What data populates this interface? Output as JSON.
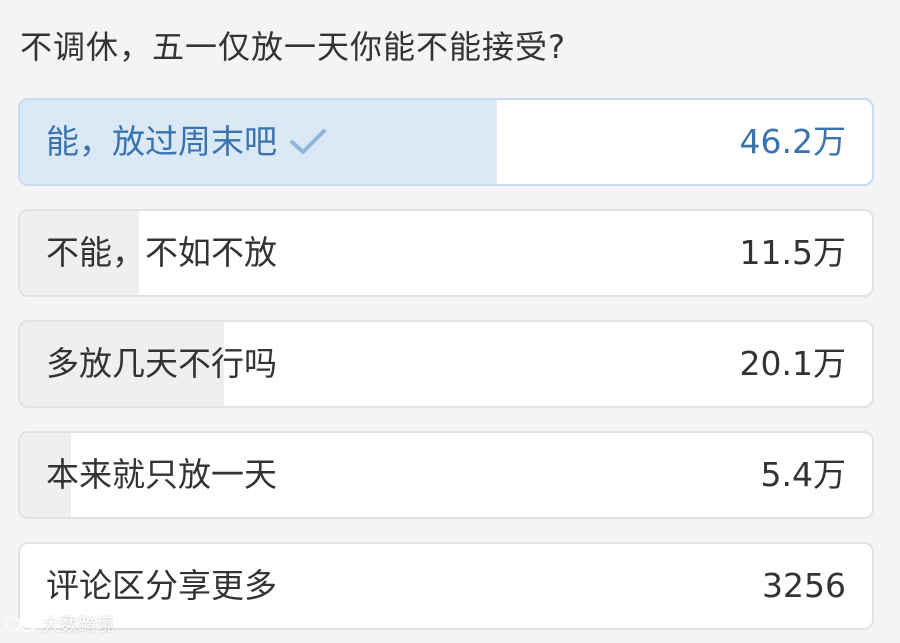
{
  "poll": {
    "question": "不调休，五一仅放一天你能不能接受?",
    "options": [
      {
        "label": "能，放过周末吧",
        "count": "46.2万",
        "share": 0.56,
        "selected": true
      },
      {
        "label": "不能，不如不放",
        "count": "11.5万",
        "share": 0.14,
        "selected": false
      },
      {
        "label": "多放几天不行吗",
        "count": "20.1万",
        "share": 0.24,
        "selected": false
      },
      {
        "label": "本来就只放一天",
        "count": "5.4万",
        "share": 0.06,
        "selected": false
      }
    ],
    "comments": {
      "label": "评论区分享更多",
      "count": "3256"
    }
  },
  "watermark": {
    "text": "大数跨境"
  },
  "colors": {
    "accent": "#3a73ad",
    "selected_fill": "#dbe9f7",
    "result_fill": "#efeff1",
    "text": "#333333"
  },
  "icons": {
    "selected": "check-icon"
  }
}
